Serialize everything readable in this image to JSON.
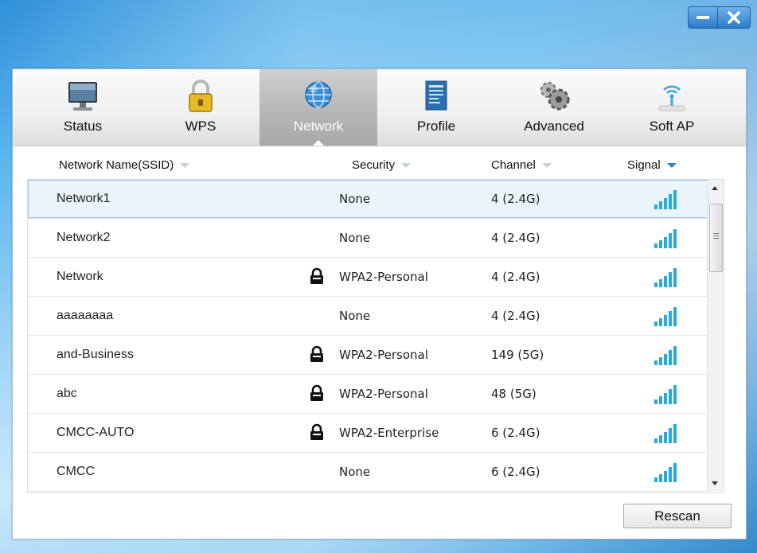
{
  "tabs": [
    {
      "label": "Status",
      "icon": "monitor-icon"
    },
    {
      "label": "WPS",
      "icon": "padlock-icon"
    },
    {
      "label": "Network",
      "icon": "globe-icon"
    },
    {
      "label": "Profile",
      "icon": "document-icon"
    },
    {
      "label": "Advanced",
      "icon": "gears-icon"
    },
    {
      "label": "Soft AP",
      "icon": "access-point-icon"
    }
  ],
  "active_tab": "Network",
  "columns": {
    "ssid": "Network Name(SSID)",
    "security": "Security",
    "channel": "Channel",
    "signal": "Signal"
  },
  "networks": [
    {
      "ssid": "Network1",
      "secured": false,
      "security": "None",
      "channel": "4 (2.4G)",
      "signal_level": 5
    },
    {
      "ssid": "Network2",
      "secured": false,
      "security": "None",
      "channel": "4 (2.4G)",
      "signal_level": 5
    },
    {
      "ssid": "Network",
      "secured": true,
      "security": "WPA2-Personal",
      "channel": "4 (2.4G)",
      "signal_level": 5
    },
    {
      "ssid": "aaaaaaaa",
      "secured": false,
      "security": "None",
      "channel": "4 (2.4G)",
      "signal_level": 5
    },
    {
      "ssid": "and-Business",
      "secured": true,
      "security": "WPA2-Personal",
      "channel": "149 (5G)",
      "signal_level": 5
    },
    {
      "ssid": "abc",
      "secured": true,
      "security": "WPA2-Personal",
      "channel": "48 (5G)",
      "signal_level": 5
    },
    {
      "ssid": "CMCC-AUTO",
      "secured": true,
      "security": "WPA2-Enterprise",
      "channel": "6 (2.4G)",
      "signal_level": 5
    },
    {
      "ssid": "CMCC",
      "secured": false,
      "security": "None",
      "channel": "6 (2.4G)",
      "signal_level": 5
    }
  ],
  "selected_row": 0,
  "rescan_label": "Rescan",
  "colors": {
    "accent": "#2b82d0",
    "signal": "#2aa8e0",
    "active_tab": "#b7b7b7"
  }
}
